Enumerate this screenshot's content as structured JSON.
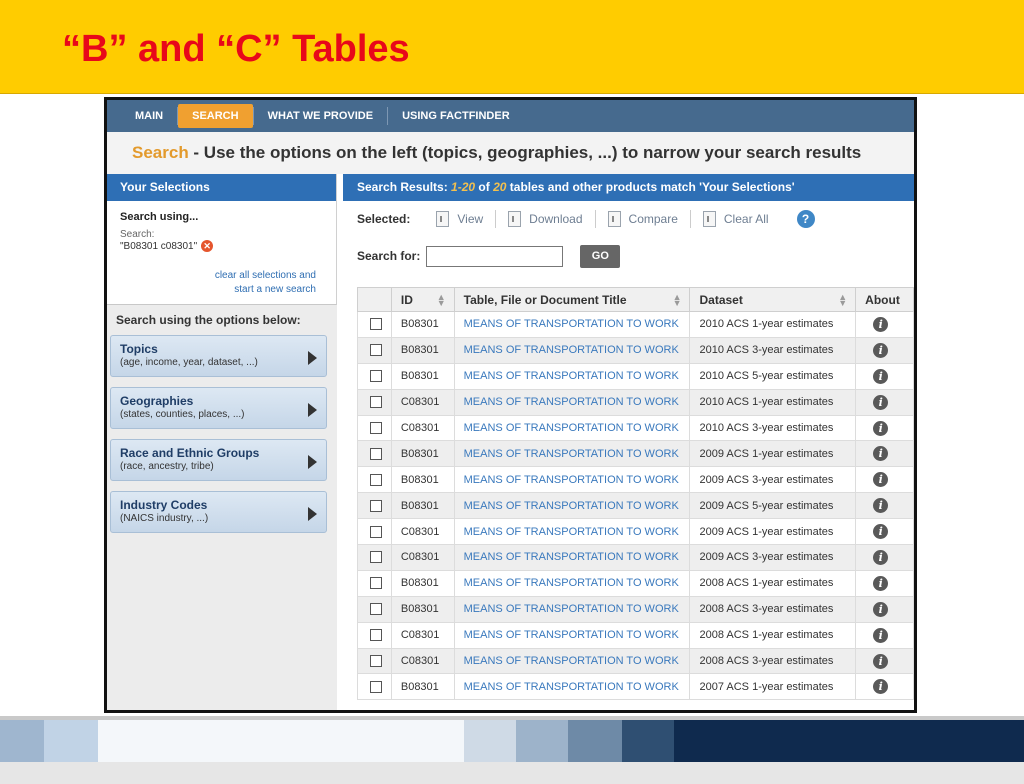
{
  "slide": {
    "title": "“B” and “C” Tables"
  },
  "nav": {
    "items": [
      {
        "label": "MAIN",
        "active": false
      },
      {
        "label": "SEARCH",
        "active": true
      },
      {
        "label": "WHAT WE PROVIDE",
        "active": false
      },
      {
        "label": "USING FACTFINDER",
        "active": false
      }
    ]
  },
  "search_header": {
    "accent": "Search",
    "text": " - Use the options on the left (topics, geographies, ...) to narrow your search results"
  },
  "selections": {
    "title": "Your Selections",
    "heading": "Search using...",
    "label": "Search:",
    "value": "\"B08301 c08301\"",
    "clear_line1": "clear all selections and",
    "clear_line2": "start a new search"
  },
  "options": {
    "title": "Search using the options below:",
    "items": [
      {
        "title": "Topics",
        "sub": "(age, income, year, dataset, ...)"
      },
      {
        "title": "Geographies",
        "sub": "(states, counties, places, ...)"
      },
      {
        "title": "Race and Ethnic Groups",
        "sub": "(race, ancestry, tribe)"
      },
      {
        "title": "Industry Codes",
        "sub": "(NAICS industry, ...)"
      }
    ]
  },
  "results": {
    "prefix": "Search Results: ",
    "range": "1-20",
    "of": " of ",
    "total": "20",
    "suffix": " tables and other products match 'Your Selections'"
  },
  "toolbar": {
    "selected_label": "Selected:",
    "view": "View",
    "download": "Download",
    "compare": "Compare",
    "clear_all": "Clear All",
    "help": "?"
  },
  "search_for": {
    "label": "Search for:",
    "value": "",
    "go": "GO"
  },
  "table": {
    "headers": {
      "id": "ID",
      "title": "Table, File or Document Title",
      "dataset": "Dataset",
      "about": "About"
    },
    "rows": [
      {
        "id": "B08301",
        "title": "MEANS OF TRANSPORTATION TO WORK",
        "dataset": "2010 ACS 1-year estimates"
      },
      {
        "id": "B08301",
        "title": "MEANS OF TRANSPORTATION TO WORK",
        "dataset": "2010 ACS 3-year estimates"
      },
      {
        "id": "B08301",
        "title": "MEANS OF TRANSPORTATION TO WORK",
        "dataset": "2010 ACS 5-year estimates"
      },
      {
        "id": "C08301",
        "title": "MEANS OF TRANSPORTATION TO WORK",
        "dataset": "2010 ACS 1-year estimates"
      },
      {
        "id": "C08301",
        "title": "MEANS OF TRANSPORTATION TO WORK",
        "dataset": "2010 ACS 3-year estimates"
      },
      {
        "id": "B08301",
        "title": "MEANS OF TRANSPORTATION TO WORK",
        "dataset": "2009 ACS 1-year estimates"
      },
      {
        "id": "B08301",
        "title": "MEANS OF TRANSPORTATION TO WORK",
        "dataset": "2009 ACS 3-year estimates"
      },
      {
        "id": "B08301",
        "title": "MEANS OF TRANSPORTATION TO WORK",
        "dataset": "2009 ACS 5-year estimates"
      },
      {
        "id": "C08301",
        "title": "MEANS OF TRANSPORTATION TO WORK",
        "dataset": "2009 ACS 1-year estimates"
      },
      {
        "id": "C08301",
        "title": "MEANS OF TRANSPORTATION TO WORK",
        "dataset": "2009 ACS 3-year estimates"
      },
      {
        "id": "B08301",
        "title": "MEANS OF TRANSPORTATION TO WORK",
        "dataset": "2008 ACS 1-year estimates"
      },
      {
        "id": "B08301",
        "title": "MEANS OF TRANSPORTATION TO WORK",
        "dataset": "2008 ACS 3-year estimates"
      },
      {
        "id": "C08301",
        "title": "MEANS OF TRANSPORTATION TO WORK",
        "dataset": "2008 ACS 1-year estimates"
      },
      {
        "id": "C08301",
        "title": "MEANS OF TRANSPORTATION TO WORK",
        "dataset": "2008 ACS 3-year estimates"
      },
      {
        "id": "B08301",
        "title": "MEANS OF TRANSPORTATION TO WORK",
        "dataset": "2007 ACS 1-year estimates"
      }
    ]
  },
  "colors": {
    "slide_header": "#ffcc00",
    "slide_title": "#e8081a",
    "nav_bg": "#466a8e",
    "nav_active": "#f0a030",
    "panel_blue": "#2e6fb5",
    "link": "#3a79bd"
  }
}
